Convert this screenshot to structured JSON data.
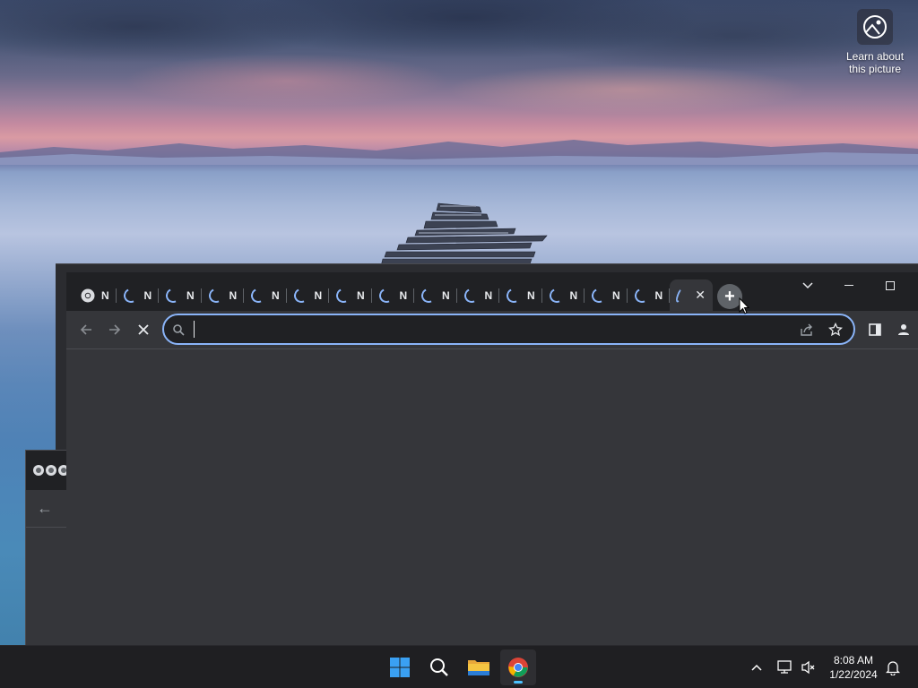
{
  "desktop": {
    "learn_label": "Learn about this picture"
  },
  "browser": {
    "tabs": [
      {
        "title": "N",
        "favicon": "chrome-favicon"
      },
      {
        "title": "N",
        "favicon": "loading-spinner"
      },
      {
        "title": "N",
        "favicon": "loading-spinner"
      },
      {
        "title": "N",
        "favicon": "loading-spinner"
      },
      {
        "title": "N",
        "favicon": "loading-spinner"
      },
      {
        "title": "N",
        "favicon": "loading-spinner"
      },
      {
        "title": "N",
        "favicon": "loading-spinner"
      },
      {
        "title": "N",
        "favicon": "loading-spinner"
      },
      {
        "title": "N",
        "favicon": "loading-spinner"
      },
      {
        "title": "N",
        "favicon": "loading-spinner"
      },
      {
        "title": "N",
        "favicon": "loading-spinner"
      },
      {
        "title": "N",
        "favicon": "loading-spinner"
      },
      {
        "title": "N",
        "favicon": "loading-spinner"
      },
      {
        "title": "N",
        "favicon": "loading-spinner"
      },
      {
        "title": "",
        "favicon": "loading-spinner",
        "active": true
      }
    ],
    "omnibox": {
      "value": "",
      "placeholder": ""
    },
    "accent_color": "#8ab4f8"
  },
  "taskbar": {
    "apps": [
      "start-icon",
      "search-icon",
      "file-explorer-icon",
      "chrome-icon"
    ],
    "time": "8:08 AM",
    "date": "1/22/2024"
  }
}
